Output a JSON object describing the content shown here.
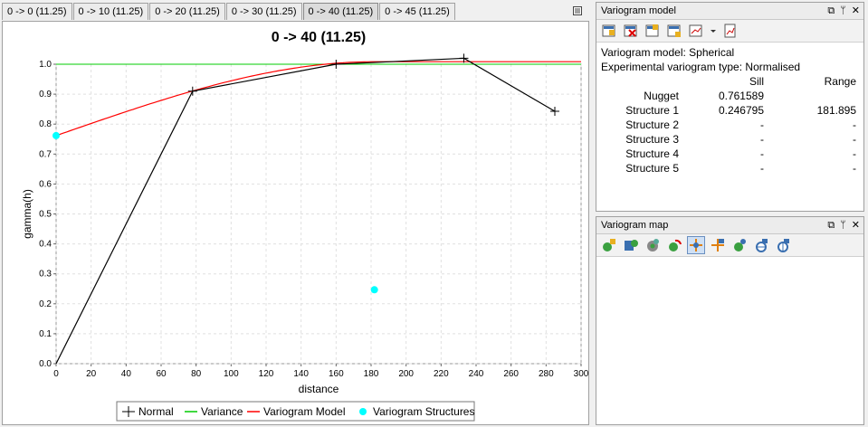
{
  "tabs": [
    "0 -> 0 (11.25)",
    "0 -> 10 (11.25)",
    "0 -> 20 (11.25)",
    "0 -> 30 (11.25)",
    "0 -> 40 (11.25)",
    "0 -> 45 (11.25)"
  ],
  "active_tab": 4,
  "chart_data": {
    "type": "line",
    "title": "0 -> 40 (11.25)",
    "xlabel": "distance",
    "ylabel": "gamma(h)",
    "xlim": [
      0,
      300
    ],
    "ylim": [
      0,
      1.0
    ],
    "x_ticks": [
      0,
      20,
      40,
      60,
      80,
      100,
      120,
      140,
      160,
      180,
      200,
      220,
      240,
      260,
      280,
      300
    ],
    "y_ticks": [
      0.0,
      0.1,
      0.2,
      0.3,
      0.4,
      0.5,
      0.6,
      0.7,
      0.8,
      0.9,
      1.0
    ],
    "grid": true,
    "legend_position": "bottom",
    "series": [
      {
        "name": "Normal",
        "color": "#000000",
        "marker": "plus",
        "x": [
          0,
          78,
          160,
          233,
          285
        ],
        "y": [
          0.0,
          0.91,
          1.0,
          1.02,
          0.843
        ]
      },
      {
        "name": "Variance",
        "color": "#00cc00",
        "x": [
          0,
          300
        ],
        "y": [
          1.0,
          1.0
        ]
      },
      {
        "name": "Variogram Model",
        "color": "#ff0000",
        "model": "spherical",
        "nugget": 0.761589,
        "sill": 0.246795,
        "range": 181.895
      },
      {
        "name": "Variogram Structures",
        "color": "#00ffff",
        "marker": "circle",
        "x": [
          0,
          181.895
        ],
        "y": [
          0.761589,
          0.246795
        ]
      }
    ]
  },
  "variogram_model_panel": {
    "title": "Variogram model",
    "model_line": "Variogram model: Spherical",
    "exp_type_line": "Experimental variogram type: Normalised",
    "col_sill": "Sill",
    "col_range": "Range",
    "rows": [
      {
        "label": "Nugget",
        "sill": "0.761589",
        "range": ""
      },
      {
        "label": "Structure 1",
        "sill": "0.246795",
        "range": "181.895"
      },
      {
        "label": "Structure 2",
        "sill": "-",
        "range": "-"
      },
      {
        "label": "Structure 3",
        "sill": "-",
        "range": "-"
      },
      {
        "label": "Structure 4",
        "sill": "-",
        "range": "-"
      },
      {
        "label": "Structure 5",
        "sill": "-",
        "range": "-"
      }
    ]
  },
  "variogram_map_panel": {
    "title": "Variogram map"
  },
  "panel_buttons": {
    "restore": "⧉",
    "pin": "ᛘ",
    "close": "✕"
  }
}
